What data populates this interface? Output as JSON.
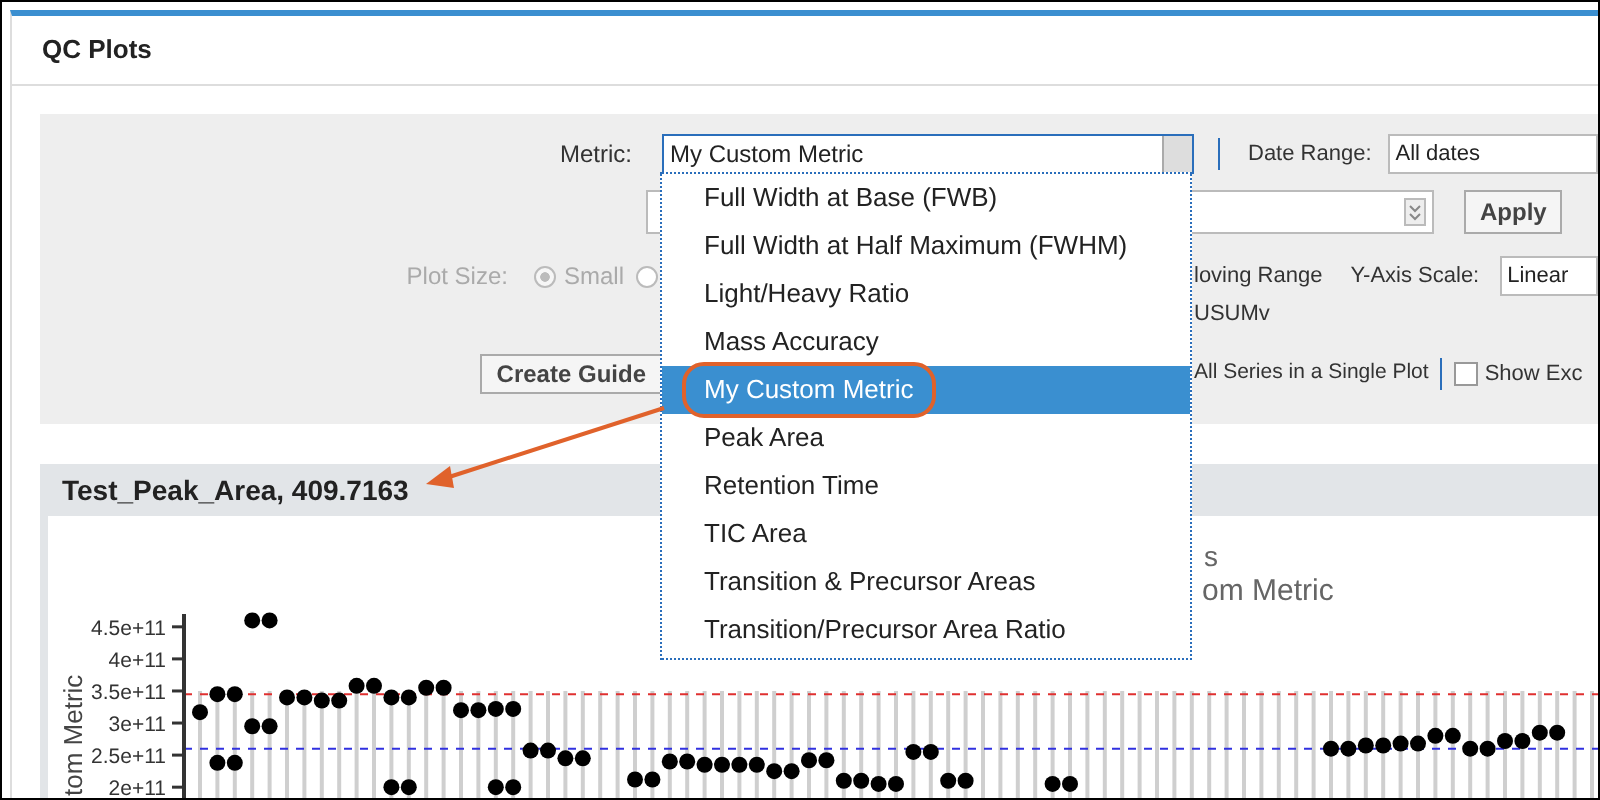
{
  "panel": {
    "title": "QC Plots"
  },
  "filters": {
    "metric": {
      "label": "Metric:",
      "value": "My Custom Metric",
      "expanded": true
    },
    "date_range": {
      "label": "Date Range:",
      "value": "All dates"
    },
    "apply_button": "Apply",
    "plot_size": {
      "label": "Plot Size:",
      "disabled": true,
      "options": [
        {
          "label": "Small",
          "selected": true
        },
        {
          "selected": false
        }
      ]
    },
    "moving_range_label": "loving Range",
    "y_axis_scale": {
      "label": "Y-Axis Scale:",
      "value": "Linear"
    },
    "cusum_label": "USUMv",
    "create_guide_button": "Create Guide",
    "single_plot_label": "All Series in a Single Plot",
    "show_excluded": {
      "label": "Show Exc",
      "checked": false
    }
  },
  "metric_options": [
    {
      "label": "Full Width at Base (FWB)",
      "selected": false,
      "callout": false
    },
    {
      "label": "Full Width at Half Maximum (FWHM)",
      "selected": false,
      "callout": false
    },
    {
      "label": "Light/Heavy Ratio",
      "selected": false,
      "callout": false
    },
    {
      "label": "Mass Accuracy",
      "selected": false,
      "callout": false
    },
    {
      "label": "My Custom Metric",
      "selected": true,
      "callout": true
    },
    {
      "label": "Peak Area",
      "selected": false,
      "callout": false
    },
    {
      "label": "Retention Time",
      "selected": false,
      "callout": false
    },
    {
      "label": "TIC Area",
      "selected": false,
      "callout": false
    },
    {
      "label": "Transition & Precursor Areas",
      "selected": false,
      "callout": false
    },
    {
      "label": "Transition/Precursor Area Ratio",
      "selected": false,
      "callout": false
    }
  ],
  "plot": {
    "series_header": {
      "label": "Test_Peak_Area, 409.7163",
      "callout": true
    },
    "title_lines": [
      "s",
      "om Metric"
    ],
    "chart_data": {
      "type": "scatter",
      "ylabel": "tom Metric",
      "ylim": [
        180000000000.0,
        470000000000.0
      ],
      "yticks": [
        {
          "value": 200000000000.0,
          "label": "2e+11"
        },
        {
          "value": 250000000000.0,
          "label": "2.5e+11"
        },
        {
          "value": 300000000000.0,
          "label": "3e+11"
        },
        {
          "value": 350000000000.0,
          "label": "3.5e+11"
        },
        {
          "value": 400000000000.0,
          "label": "4e+11"
        },
        {
          "value": 450000000000.0,
          "label": "4.5e+11"
        }
      ],
      "series": [
        {
          "color": "#000000",
          "values": [
            317000000000.0,
            345000000000.0,
            345000000000.0,
            460000000000.0,
            460000000000.0,
            340000000000.0,
            340000000000.0,
            335000000000.0,
            335000000000.0,
            358000000000.0,
            358000000000.0,
            340000000000.0,
            340000000000.0,
            355000000000.0,
            355000000000.0,
            320000000000.0,
            320000000000.0,
            322000000000.0,
            322000000000.0,
            257000000000.0,
            257000000000.0,
            245000000000.0,
            245000000000.0,
            null,
            null,
            212000000000.0,
            212000000000.0,
            240000000000.0,
            240000000000.0,
            235000000000.0,
            235000000000.0,
            235000000000.0,
            235000000000.0,
            225000000000.0,
            225000000000.0,
            242000000000.0,
            242000000000.0,
            210000000000.0,
            210000000000.0,
            205000000000.0,
            205000000000.0,
            255000000000.0,
            255000000000.0,
            210000000000.0,
            210000000000.0,
            null,
            null,
            null,
            null,
            205000000000.0,
            205000000000.0,
            null,
            null,
            null,
            null,
            null,
            null,
            null,
            null,
            null,
            null,
            null,
            null,
            null,
            null,
            260000000000.0,
            260000000000.0,
            265000000000.0,
            265000000000.0,
            268000000000.0,
            268000000000.0,
            280000000000.0,
            280000000000.0,
            260000000000.0,
            260000000000.0,
            272000000000.0,
            272000000000.0,
            285000000000.0,
            285000000000.0,
            null,
            null
          ]
        },
        {
          "color": "#000000",
          "values": [
            null,
            238000000000.0,
            238000000000.0,
            295000000000.0,
            295000000000.0,
            null,
            null,
            null,
            null,
            null,
            null,
            200000000000.0,
            200000000000.0,
            null,
            null,
            null,
            null,
            200000000000.0,
            200000000000.0
          ]
        }
      ],
      "ref_lines": [
        {
          "axis": "y",
          "value": 345000000000.0,
          "color": "#e03030"
        },
        {
          "axis": "y",
          "value": 260000000000.0,
          "color": "#3030e0"
        }
      ]
    }
  }
}
